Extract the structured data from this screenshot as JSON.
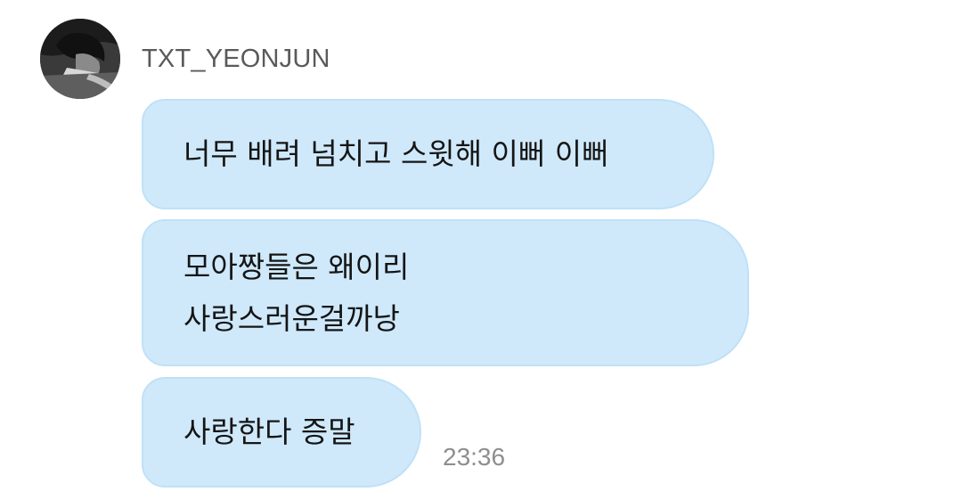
{
  "chat": {
    "sender": {
      "name": "TXT_YEONJUN",
      "avatar_icon": "profile-photo"
    },
    "messages": [
      {
        "lines": [
          "너무 배려 넘치고 스윗해 이뻐 이뻐"
        ]
      },
      {
        "lines": [
          "모아짱들은 왜이리",
          "사랑스러운걸까낭"
        ]
      },
      {
        "lines": [
          "사랑한다 증말"
        ]
      }
    ],
    "timestamp": "23:36"
  },
  "colors": {
    "bubble_fill": "#cfe9fb",
    "bubble_border": "#bfe1f7",
    "sender_text": "#5a5a5a",
    "timestamp_text": "#8e8e8e",
    "message_text": "#151515"
  }
}
